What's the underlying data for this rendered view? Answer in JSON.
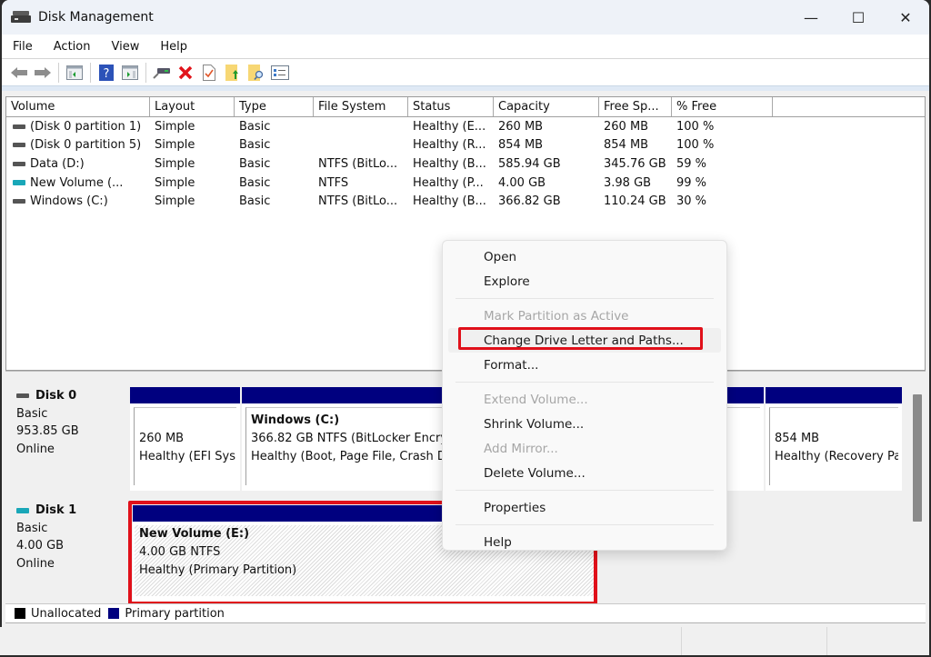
{
  "window": {
    "title": "Disk Management",
    "controls": {
      "minimize": "—",
      "maximize": "☐",
      "close": "✕"
    }
  },
  "menubar": [
    "File",
    "Action",
    "View",
    "Help"
  ],
  "toolbar": {
    "buttons": [
      "back-icon",
      "forward-icon",
      "show-hide-console-tree-icon",
      "help-icon",
      "show-hide-action-pane-icon",
      "connect-drive-icon",
      "delete-icon",
      "checklist-icon",
      "folder-up-icon",
      "folder-search-icon",
      "properties-list-icon"
    ]
  },
  "volume_list": {
    "columns": [
      "Volume",
      "Layout",
      "Type",
      "File System",
      "Status",
      "Capacity",
      "Free Sp...",
      "% Free"
    ],
    "rows": [
      {
        "volume": "(Disk 0 partition 1)",
        "icon": "disk",
        "layout": "Simple",
        "type": "Basic",
        "fs": "",
        "status": "Healthy (E...",
        "capacity": "260 MB",
        "free": "260 MB",
        "pct": "100 %"
      },
      {
        "volume": "(Disk 0 partition 5)",
        "icon": "disk",
        "layout": "Simple",
        "type": "Basic",
        "fs": "",
        "status": "Healthy (R...",
        "capacity": "854 MB",
        "free": "854 MB",
        "pct": "100 %"
      },
      {
        "volume": "Data (D:)",
        "icon": "disk",
        "layout": "Simple",
        "type": "Basic",
        "fs": "NTFS (BitLo...",
        "status": "Healthy (B...",
        "capacity": "585.94 GB",
        "free": "345.76 GB",
        "pct": "59 %"
      },
      {
        "volume": "New Volume (...",
        "icon": "usb",
        "layout": "Simple",
        "type": "Basic",
        "fs": "NTFS",
        "status": "Healthy (P...",
        "capacity": "4.00 GB",
        "free": "3.98 GB",
        "pct": "99 %"
      },
      {
        "volume": "Windows  (C:)",
        "icon": "disk",
        "layout": "Simple",
        "type": "Basic",
        "fs": "NTFS (BitLo...",
        "status": "Healthy (B...",
        "capacity": "366.82 GB",
        "free": "110.24 GB",
        "pct": "30 %"
      }
    ]
  },
  "disks": [
    {
      "name": "Disk 0",
      "kind": "Basic",
      "size": "953.85 GB",
      "state": "Online",
      "partitions": [
        {
          "name": "",
          "line1": "260 MB",
          "line2": "Healthy (EFI Sys"
        },
        {
          "name": "Windows   (C:)",
          "line1": "366.82 GB NTFS (BitLocker Encry",
          "line2": "Healthy (Boot, Page File, Crash D"
        },
        {
          "name": "",
          "line1": "",
          "line2": ""
        },
        {
          "name": "",
          "line1": "854 MB",
          "line2": "Healthy (Recovery Pa"
        }
      ]
    },
    {
      "name": "Disk 1",
      "kind": "Basic",
      "size": "4.00 GB",
      "state": "Online",
      "partitions": [
        {
          "name": "New Volume  (E:)",
          "line1": "4.00 GB NTFS",
          "line2": "Healthy (Primary Partition)"
        }
      ]
    }
  ],
  "legend": [
    {
      "label": "Unallocated",
      "color": "#000000"
    },
    {
      "label": "Primary partition",
      "color": "#00007f"
    }
  ],
  "context_menu": {
    "items": [
      {
        "label": "Open",
        "enabled": true
      },
      {
        "label": "Explore",
        "enabled": true
      },
      {
        "separator": true
      },
      {
        "label": "Mark Partition as Active",
        "enabled": false
      },
      {
        "label": "Change Drive Letter and Paths...",
        "enabled": true,
        "highlighted": true
      },
      {
        "label": "Format...",
        "enabled": true
      },
      {
        "separator": true
      },
      {
        "label": "Extend Volume...",
        "enabled": false
      },
      {
        "label": "Shrink Volume...",
        "enabled": true
      },
      {
        "label": "Add Mirror...",
        "enabled": false
      },
      {
        "label": "Delete Volume...",
        "enabled": true
      },
      {
        "separator": true
      },
      {
        "label": "Properties",
        "enabled": true
      },
      {
        "separator": true
      },
      {
        "label": "Help",
        "enabled": true
      }
    ]
  },
  "colors": {
    "primary_partition": "#00007f",
    "highlight_outline": "#e0101a",
    "usb_drive": "#19a7b8"
  }
}
